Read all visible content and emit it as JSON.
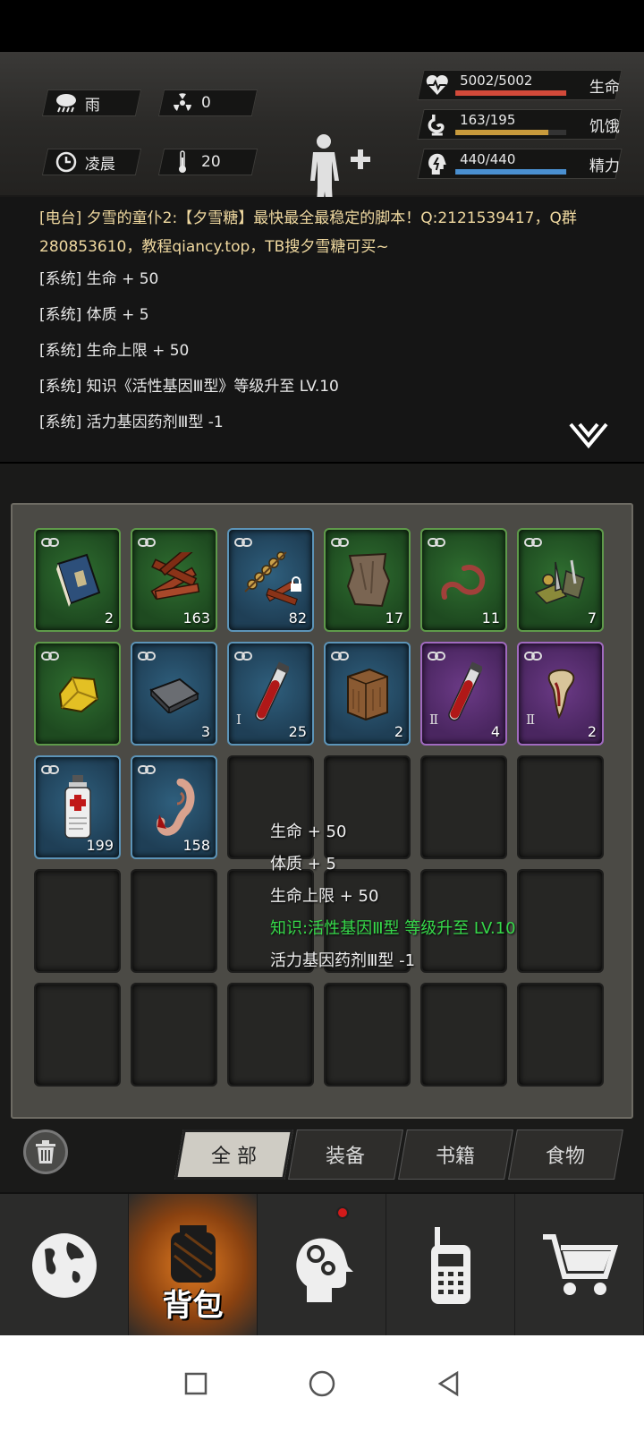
{
  "hud": {
    "weather": {
      "label": "雨",
      "icon": "rain-cloud-icon"
    },
    "radiation": {
      "value": "0",
      "icon": "radiation-icon"
    },
    "time": {
      "label": "凌晨",
      "icon": "clock-icon"
    },
    "temperature": {
      "value": "20",
      "icon": "thermometer-icon"
    },
    "stats": [
      {
        "key": "health",
        "value": "5002/5002",
        "label": "生命",
        "fraction": 1.0,
        "color": "#d34a3a",
        "icon": "heart-pulse-icon"
      },
      {
        "key": "hunger",
        "value": "163/195",
        "label": "饥饿",
        "fraction": 0.836,
        "color": "#c89a3c",
        "icon": "stomach-icon"
      },
      {
        "key": "energy",
        "value": "440/440",
        "label": "精力",
        "fraction": 1.0,
        "color": "#4a8fd0",
        "icon": "energy-head-icon"
      }
    ]
  },
  "log": {
    "radio": "[电台] 夕雪的童仆2:【夕雪糖】最快最全最稳定的脚本！Q:2121539417，Q群280853610，教程qiancy.top，TB搜夕雪糖可买~",
    "lines": [
      "[系统] 生命 + 50",
      "[系统] 体质 + 5",
      "[系统] 生命上限 + 50",
      "[系统] 知识《活性基因Ⅲ型》等级升至 LV.10",
      "[系统] 活力基因药剂Ⅲ型 -1"
    ]
  },
  "inventory": {
    "slots": [
      {
        "rarity": "green",
        "item": "book",
        "count": "2"
      },
      {
        "rarity": "green",
        "item": "wood",
        "count": "163"
      },
      {
        "rarity": "blue",
        "item": "skewers",
        "count": "82",
        "locked": true
      },
      {
        "rarity": "green",
        "item": "hide",
        "count": "17"
      },
      {
        "rarity": "green",
        "item": "worm",
        "count": "11"
      },
      {
        "rarity": "green",
        "item": "scrap",
        "count": "7"
      },
      {
        "rarity": "green",
        "item": "gold-ore",
        "count": ""
      },
      {
        "rarity": "blue",
        "item": "metal-ingot",
        "count": "3"
      },
      {
        "rarity": "blue",
        "item": "blood-vial",
        "count": "25",
        "tier": "Ⅰ"
      },
      {
        "rarity": "blue",
        "item": "wood-block",
        "count": "2"
      },
      {
        "rarity": "purple",
        "item": "blood-vial",
        "count": "4",
        "tier": "Ⅱ"
      },
      {
        "rarity": "purple",
        "item": "fang",
        "count": "2",
        "tier": "Ⅱ"
      },
      {
        "rarity": "blue",
        "item": "medkit-bottle",
        "count": "199"
      },
      {
        "rarity": "blue",
        "item": "ear",
        "count": "158"
      },
      {
        "rarity": "empty"
      },
      {
        "rarity": "empty"
      },
      {
        "rarity": "empty"
      },
      {
        "rarity": "empty"
      },
      {
        "rarity": "empty"
      },
      {
        "rarity": "empty"
      },
      {
        "rarity": "empty"
      },
      {
        "rarity": "empty"
      },
      {
        "rarity": "empty"
      },
      {
        "rarity": "empty"
      },
      {
        "rarity": "empty"
      },
      {
        "rarity": "empty"
      },
      {
        "rarity": "empty"
      },
      {
        "rarity": "empty"
      },
      {
        "rarity": "empty"
      },
      {
        "rarity": "empty"
      }
    ]
  },
  "tooltip": {
    "lines": [
      {
        "text": "生命 + 50",
        "color": "white"
      },
      {
        "text": "体质 + 5",
        "color": "white"
      },
      {
        "text": "生命上限 + 50",
        "color": "white"
      },
      {
        "text": "知识:活性基因Ⅲ型 等级升至 LV.10",
        "color": "green"
      },
      {
        "text": "活力基因药剂Ⅲ型 -1",
        "color": "white"
      }
    ]
  },
  "tabs": [
    "全 部",
    "装备",
    "书籍",
    "食物"
  ],
  "active_tab": 0,
  "nav": {
    "items": [
      {
        "name": "world-map",
        "icon": "globe-icon",
        "label": ""
      },
      {
        "name": "backpack",
        "icon": "backpack-icon",
        "label": "背包",
        "active": true
      },
      {
        "name": "skills",
        "icon": "brain-gear-icon",
        "label": "",
        "badge": true
      },
      {
        "name": "radio",
        "icon": "walkie-talkie-icon",
        "label": ""
      },
      {
        "name": "shop",
        "icon": "cart-icon",
        "label": ""
      }
    ]
  }
}
